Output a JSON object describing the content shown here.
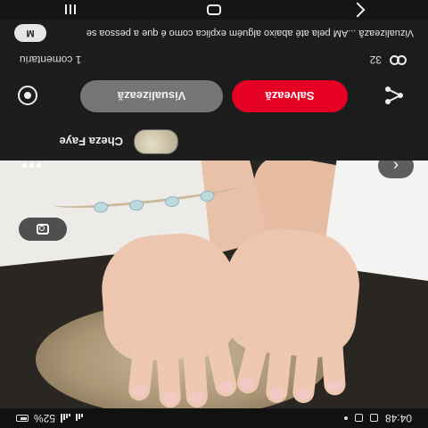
{
  "status": {
    "time": "04:48",
    "battery": "52%"
  },
  "photo": {
    "lens_icon": "visual-search-icon",
    "back_icon": "back-arrow-icon",
    "more_icon": "more-dots-icon"
  },
  "pin": {
    "author": "Cheza Faye"
  },
  "actions": {
    "view_label": "Visualizează",
    "save_label": "Salvează",
    "share_icon": "share-icon",
    "comment_icon": "comment-icon",
    "accent_color": "#e60023"
  },
  "reactions": {
    "count": "32",
    "comments": "1 comentariu"
  },
  "comment": {
    "avatar_letter": "M",
    "text": "Vizualizează ...AM pela até abaixo alguém explica como é que a pessoa se"
  },
  "navbar": {
    "back": "back-icon",
    "home": "home-icon",
    "recents": "recents-icon"
  }
}
